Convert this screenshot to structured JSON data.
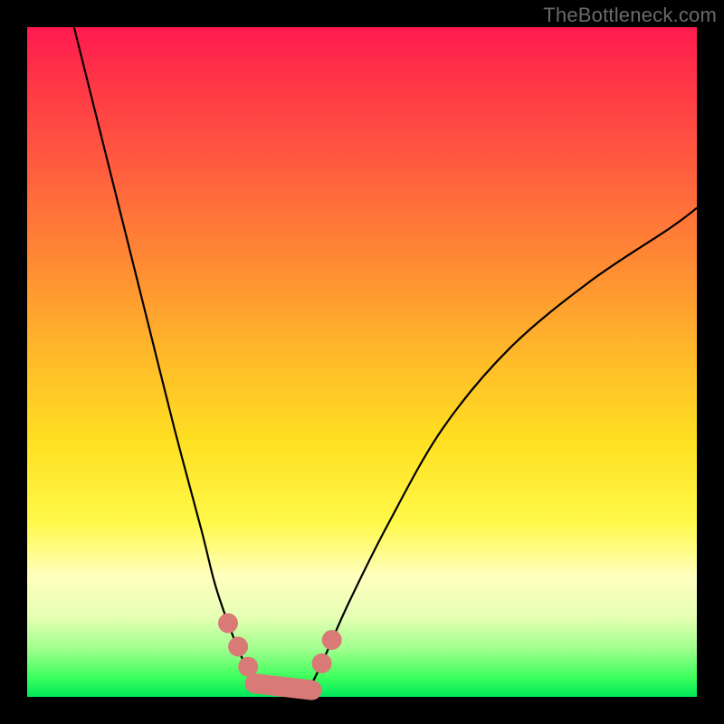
{
  "watermark": "TheBottleneck.com",
  "chart_data": {
    "type": "line",
    "title": "",
    "xlabel": "",
    "ylabel": "",
    "xlim": [
      0,
      100
    ],
    "ylim": [
      0,
      100
    ],
    "grid": false,
    "legend": false,
    "background_gradient": {
      "top": "#ff1a4f",
      "bottom": "#00e85a"
    },
    "series": [
      {
        "name": "left-branch",
        "x": [
          7,
          10,
          14,
          18,
          22,
          26,
          28,
          30,
          32,
          33.5
        ],
        "values": [
          100,
          88,
          72,
          56,
          40,
          25,
          17,
          11,
          6,
          3
        ]
      },
      {
        "name": "right-branch",
        "x": [
          42,
          44,
          48,
          54,
          62,
          72,
          84,
          96,
          100
        ],
        "values": [
          1,
          5,
          14,
          26,
          40,
          52,
          62,
          70,
          73
        ]
      },
      {
        "name": "floor",
        "x": [
          33.5,
          36,
          38,
          40,
          42
        ],
        "values": [
          3,
          1,
          0.5,
          0.5,
          1
        ]
      }
    ],
    "markers": [
      {
        "cx": 30.0,
        "cy": 11.0,
        "r": 11
      },
      {
        "cx": 31.5,
        "cy": 7.5,
        "r": 11
      },
      {
        "cx": 33.0,
        "cy": 4.5,
        "r": 11
      },
      {
        "cx": 44.0,
        "cy": 5.0,
        "r": 11
      },
      {
        "cx": 45.5,
        "cy": 8.5,
        "r": 11
      }
    ],
    "marker_segment": {
      "x1": 34.0,
      "y1": 2.0,
      "x2": 42.5,
      "y2": 1.0
    }
  }
}
